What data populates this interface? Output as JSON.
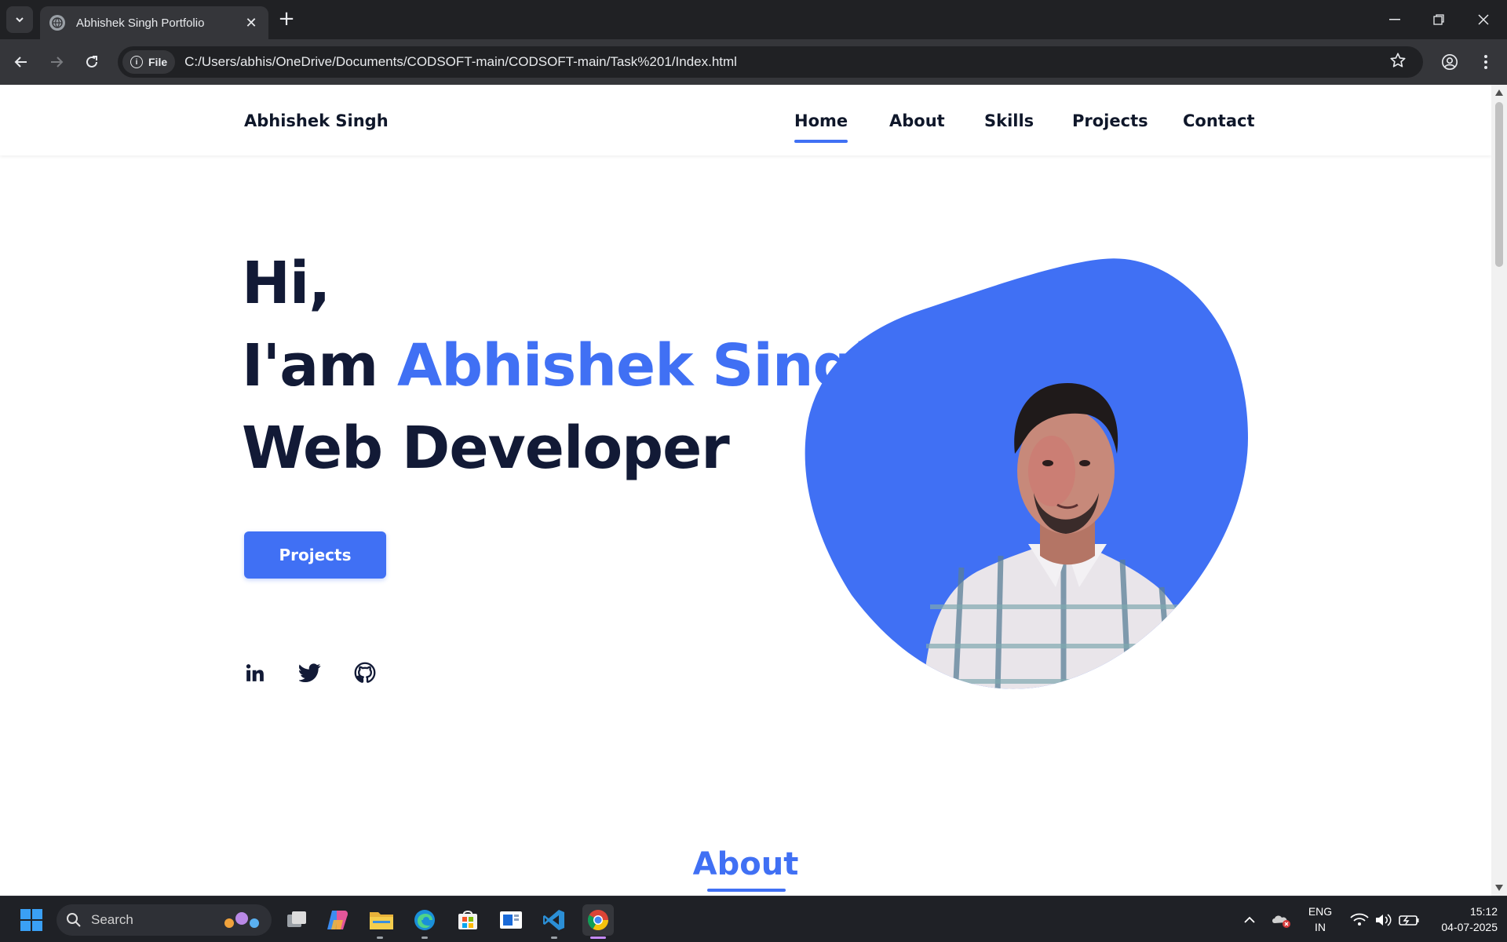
{
  "browser": {
    "tab_title": "Abhishek Singh Portfolio",
    "url_chip": "File",
    "url": "C:/Users/abhis/OneDrive/Documents/CODSOFT-main/CODSOFT-main/Task%201/Index.html"
  },
  "site": {
    "logo": "Abhishek Singh",
    "nav": [
      "Home",
      "About",
      "Skills",
      "Projects",
      "Contact"
    ],
    "active_nav": "Home",
    "hero": {
      "greeting": "Hi,",
      "intro_prefix": "I'am",
      "name": "Abhishek Singh",
      "role": "Web Developer"
    },
    "cta_label": "Projects",
    "social_icons": [
      "linkedin-icon",
      "twitter-icon",
      "github-icon"
    ],
    "about_heading": "About",
    "accent_color": "#4070f4",
    "text_color": "#121a36"
  },
  "taskbar": {
    "search_label": "Search",
    "lang_line1": "ENG",
    "lang_line2": "IN",
    "time": "15:12",
    "date": "04-07-2025"
  }
}
